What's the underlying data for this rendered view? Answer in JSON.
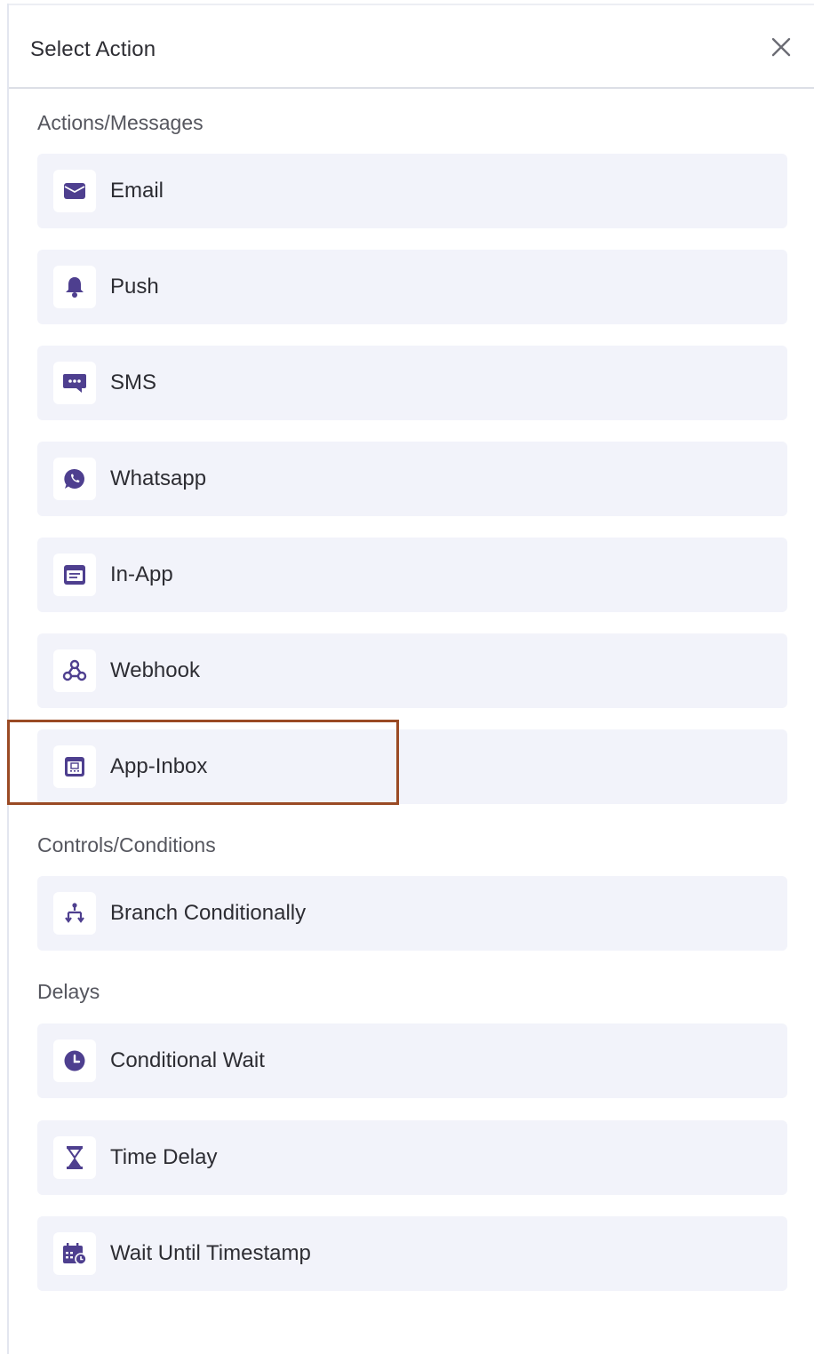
{
  "header": {
    "title": "Select Action",
    "close_icon": "close-icon"
  },
  "sections": [
    {
      "label": "Actions/Messages",
      "items": [
        {
          "label": "Email",
          "icon": "envelope-icon"
        },
        {
          "label": "Push",
          "icon": "bell-icon"
        },
        {
          "label": "SMS",
          "icon": "chat-bubble-icon"
        },
        {
          "label": "Whatsapp",
          "icon": "whatsapp-icon"
        },
        {
          "label": "In-App",
          "icon": "in-app-message-icon"
        },
        {
          "label": "Webhook",
          "icon": "webhook-icon"
        },
        {
          "label": "App-Inbox",
          "icon": "app-inbox-icon"
        }
      ]
    },
    {
      "label": "Controls/Conditions",
      "items": [
        {
          "label": "Branch Conditionally",
          "icon": "branch-icon"
        }
      ]
    },
    {
      "label": "Delays",
      "items": [
        {
          "label": "Conditional Wait",
          "icon": "clock-icon"
        },
        {
          "label": "Time Delay",
          "icon": "hourglass-icon"
        },
        {
          "label": "Wait Until Timestamp",
          "icon": "calendar-clock-icon"
        }
      ]
    }
  ],
  "colors": {
    "accent": "#4e3f8f",
    "item_bg": "#f2f3fa",
    "highlight": "#9a4a24"
  }
}
